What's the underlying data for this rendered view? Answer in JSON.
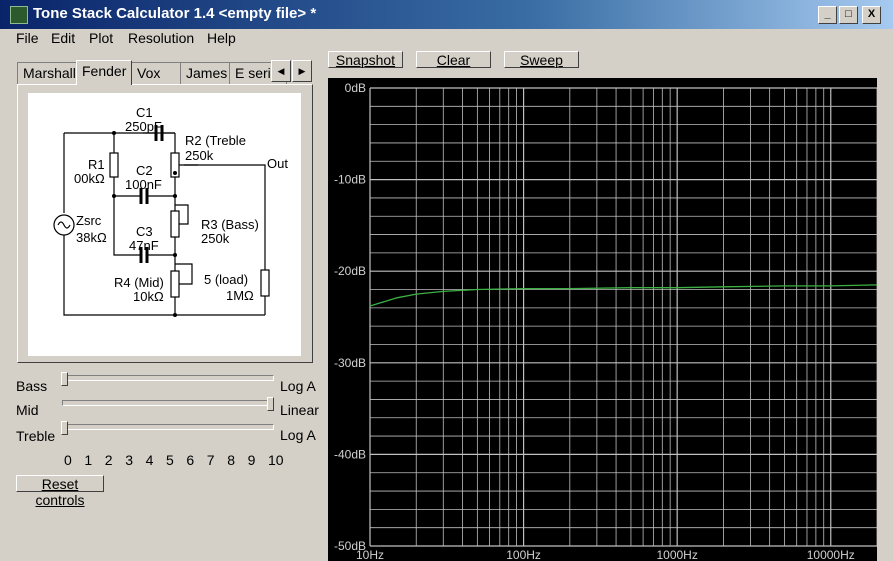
{
  "window": {
    "title": "Tone Stack Calculator 1.4 <empty file> *",
    "minimize": "_",
    "maximize": "□",
    "close": "X"
  },
  "menu": [
    "File",
    "Edit",
    "Plot",
    "Resolution",
    "Help"
  ],
  "tabs": {
    "items": [
      "Marshall",
      "Fender",
      "Vox",
      "James",
      "E serie"
    ],
    "active": "Fender",
    "left_arrow": "◀",
    "right_arrow": "▶"
  },
  "schematic": {
    "c1_name": "C1",
    "c1_value": "250pF",
    "r2_name": "R2 (Treble",
    "r2_value": "250k",
    "r1_name": "R1",
    "r1_value": "00kΩ",
    "c2_name": "C2",
    "c2_value": "100nF",
    "out": "Out",
    "zsrc_name": "Zsrc",
    "zsrc_value": "38kΩ",
    "r3_name": "R3 (Bass)",
    "r3_value": "250k",
    "c3_name": "C3",
    "c3_value": "47nF",
    "r4_name": "R4 (Mid)",
    "r4_value": "10kΩ",
    "r5_name": "5 (load)",
    "r5_value": "1MΩ"
  },
  "controls": {
    "bass": {
      "label": "Bass",
      "taper": "Log A",
      "position": 0
    },
    "mid": {
      "label": "Mid",
      "taper": "Linear",
      "position": 10
    },
    "treble": {
      "label": "Treble",
      "taper": "Log A",
      "position": 0
    },
    "scale": [
      "0",
      "1",
      "2",
      "3",
      "4",
      "5",
      "6",
      "7",
      "8",
      "9",
      "10"
    ],
    "reset": "Reset controls"
  },
  "toolbar": {
    "snapshot": "Snapshot",
    "clear": "Clear",
    "sweep": "Sweep"
  },
  "chart_data": {
    "type": "line",
    "x_scale": "log",
    "xlim": [
      10,
      20000
    ],
    "ylim": [
      -50,
      0
    ],
    "y_ticks": [
      "0dB",
      "-10dB",
      "-20dB",
      "-30dB",
      "-40dB",
      "-50dB"
    ],
    "x_ticks": [
      "10Hz",
      "100Hz",
      "1000Hz",
      "10000Hz"
    ],
    "grid": true,
    "background": "#000000",
    "grid_color": "#c0c0c0",
    "series": [
      {
        "color": "#3cb043",
        "x": [
          10,
          15,
          20,
          30,
          50,
          100,
          200,
          500,
          1000,
          2000,
          5000,
          10000,
          20000
        ],
        "y": [
          -23.8,
          -22.9,
          -22.5,
          -22.2,
          -22.0,
          -21.9,
          -21.9,
          -21.8,
          -21.8,
          -21.7,
          -21.6,
          -21.6,
          -21.5
        ]
      }
    ]
  }
}
